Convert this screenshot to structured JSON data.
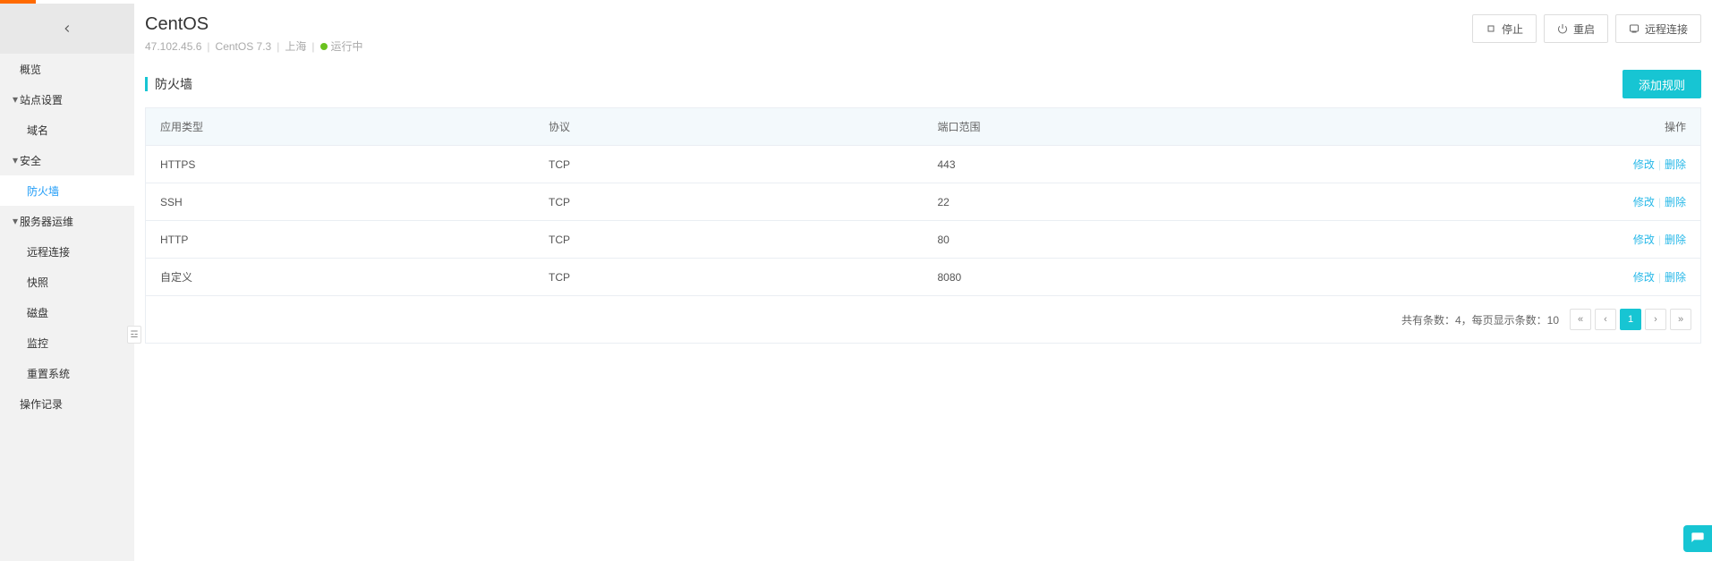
{
  "header": {
    "title": "CentOS",
    "ip": "47.102.45.6",
    "os": "CentOS 7.3",
    "region": "上海",
    "status_text": "运行中",
    "status_color": "#6ac21f",
    "buttons": {
      "stop": "停止",
      "restart": "重启",
      "remote": "远程连接"
    }
  },
  "sidebar": {
    "overview": "概览",
    "site_group": "站点设置",
    "site_items": {
      "domain": "域名"
    },
    "security_group": "安全",
    "security_items": {
      "firewall": "防火墙"
    },
    "ops_group": "服务器运维",
    "ops_items": {
      "remote": "远程连接",
      "snapshot": "快照",
      "disk": "磁盘",
      "monitor": "监控",
      "reinstall": "重置系统"
    },
    "logs": "操作记录"
  },
  "section": {
    "title": "防火墙",
    "add_rule": "添加规则"
  },
  "table": {
    "columns": {
      "app": "应用类型",
      "proto": "协议",
      "port": "端口范围",
      "action": "操作"
    },
    "actions": {
      "edit": "修改",
      "delete": "删除"
    },
    "rows": [
      {
        "app": "HTTPS",
        "proto": "TCP",
        "port": "443"
      },
      {
        "app": "SSH",
        "proto": "TCP",
        "port": "22"
      },
      {
        "app": "HTTP",
        "proto": "TCP",
        "port": "80"
      },
      {
        "app": "自定义",
        "proto": "TCP",
        "port": "8080"
      }
    ]
  },
  "pagination": {
    "count_text": "共有条数：4，每页显示条数：10",
    "first": "«",
    "prev": "‹",
    "page1": "1",
    "next": "›",
    "last": "»"
  }
}
